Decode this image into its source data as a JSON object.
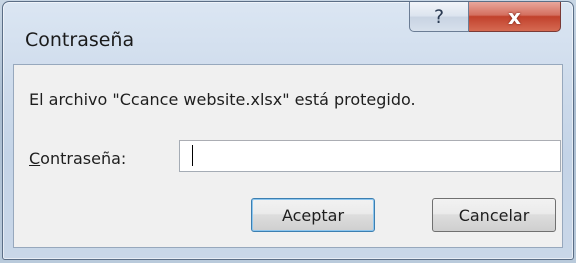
{
  "dialog": {
    "title": "Contraseña",
    "help_glyph": "?",
    "close_glyph": "x",
    "message": "El archivo \"Ccance website.xlsx\" está protegido.",
    "password_label_mnemonic": "C",
    "password_label_rest": "ontraseña:",
    "password_value": "",
    "ok_label": "Aceptar",
    "cancel_label": "Cancelar"
  },
  "colors": {
    "close_button": "#c1412c",
    "default_button_border": "#3c7fb1",
    "dialog_background": "#f0f0f0"
  }
}
